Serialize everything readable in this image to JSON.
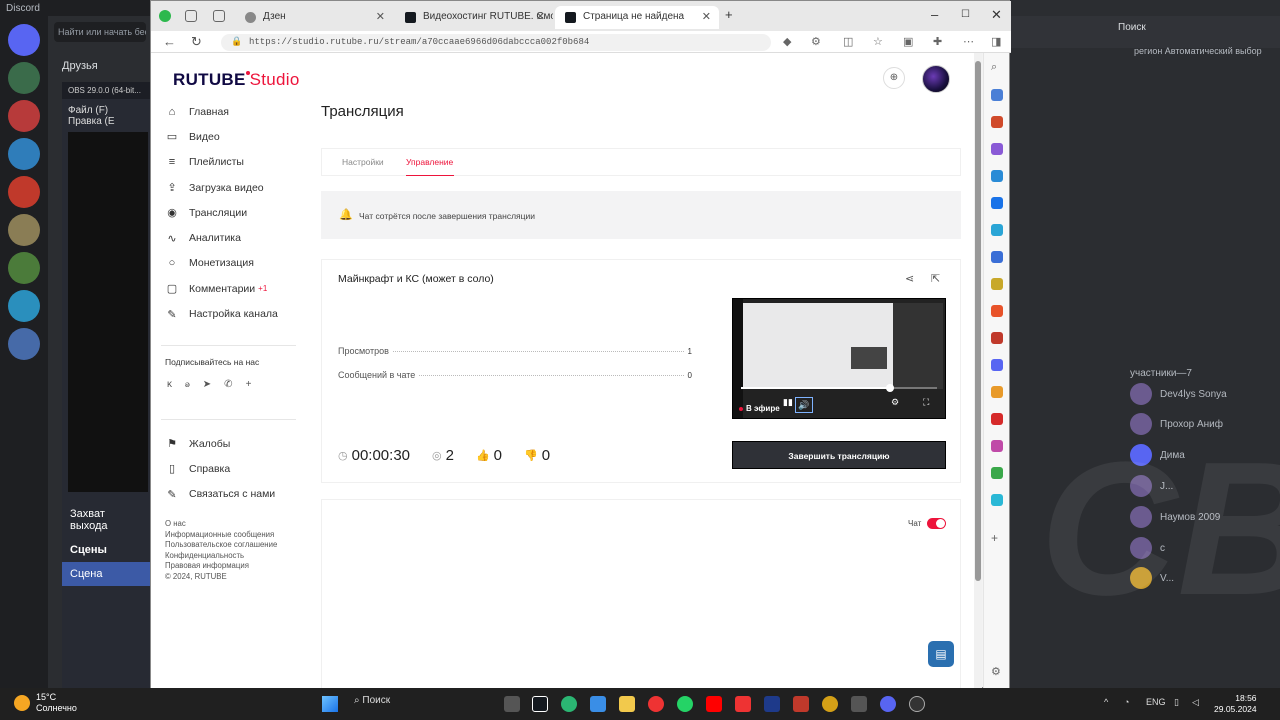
{
  "discord": {
    "title": "Discord",
    "search": "Найти или начать беседу",
    "friends": "Друзья",
    "members_title": "участники—7",
    "right_search": "Поиск",
    "region": "регион  Автоматический выбор",
    "members": [
      "Dev4lys Sonya",
      "Прохор Аниф",
      "Дима",
      "J...",
      "Наумов 2009",
      "c",
      "V..."
    ],
    "watermark": "CB!"
  },
  "obs": {
    "title": "OBS 29.0.0 (64-bit...",
    "menu": "Файл (F)  Правка (E",
    "audio": "Захват выхода",
    "scenes_title": "Сцены",
    "scene_active": "Сцена"
  },
  "browser": {
    "tabs": [
      {
        "label": "Дзен",
        "active": false
      },
      {
        "label": "Видеохостинг RUTUBE. Смотри...",
        "active": false
      },
      {
        "label": "Страница не найдена",
        "active": true
      }
    ],
    "url": "https://studio.rutube.ru/stream/a70ccaae6966d06dabccca002f0b684"
  },
  "studio": {
    "logo_main": "RUTUBE",
    "logo_studio": "Studio",
    "nav": [
      {
        "icon": "home-icon",
        "glyph": "⌂",
        "label": "Главная"
      },
      {
        "icon": "video-icon",
        "glyph": "▭",
        "label": "Видео"
      },
      {
        "icon": "playlist-icon",
        "glyph": "≡",
        "label": "Плейлисты"
      },
      {
        "icon": "upload-icon",
        "glyph": "⇪",
        "label": "Загрузка видео"
      },
      {
        "icon": "broadcast-icon",
        "glyph": "◉",
        "label": "Трансляции"
      },
      {
        "icon": "analytics-icon",
        "glyph": "∿",
        "label": "Аналитика"
      },
      {
        "icon": "monetization-icon",
        "glyph": "○",
        "label": "Монетизация"
      },
      {
        "icon": "comments-icon",
        "glyph": "▢",
        "label": "Комментарии",
        "badge": "+1"
      },
      {
        "icon": "settings-icon",
        "glyph": "✎",
        "label": "Настройка канала"
      }
    ],
    "subscribe_label": "Подписывайтесь на нас",
    "socials": [
      {
        "icon": "vk-icon",
        "glyph": "ᴋ"
      },
      {
        "icon": "ok-icon",
        "glyph": "ꭷ"
      },
      {
        "icon": "telegram-icon",
        "glyph": "➤"
      },
      {
        "icon": "viber-icon",
        "glyph": "✆"
      },
      {
        "icon": "more-icon",
        "glyph": "+"
      }
    ],
    "nav2": [
      {
        "icon": "flag-icon",
        "glyph": "⚑",
        "label": "Жалобы"
      },
      {
        "icon": "help-icon",
        "glyph": "▯",
        "label": "Справка"
      },
      {
        "icon": "contact-icon",
        "glyph": "✎",
        "label": "Связаться с нами"
      }
    ],
    "footer_links": [
      "О нас",
      "Информационные сообщения",
      "Пользовательское соглашение",
      "Конфиденциальность",
      "Правовая информация",
      "© 2024, RUTUBE"
    ],
    "page_title": "Трансляция",
    "tabs": [
      "Настройки",
      "Управление"
    ],
    "active_tab": "Управление",
    "notice": "Чат сотрётся после завершения трансляции",
    "stream_title": "Майнкрафт и КС (может в соло)",
    "stats": [
      {
        "label": "Просмотров",
        "value": "1"
      },
      {
        "label": "Сообщений в чате",
        "value": "0"
      }
    ],
    "duration": "00:00:30",
    "viewers": "2",
    "likes": "0",
    "dislikes": "0",
    "player_live": "В эфире",
    "player_progress": 0.76,
    "end_button": "Завершить трансляцию",
    "chat_label": "Чат",
    "chat_enabled": true,
    "accent": "#ed143b"
  },
  "taskbar": {
    "temp": "15°C",
    "weather": "Солнечно",
    "search": "Поиск",
    "lang": "ENG",
    "time": "18:56",
    "date": "29.05.2024"
  }
}
